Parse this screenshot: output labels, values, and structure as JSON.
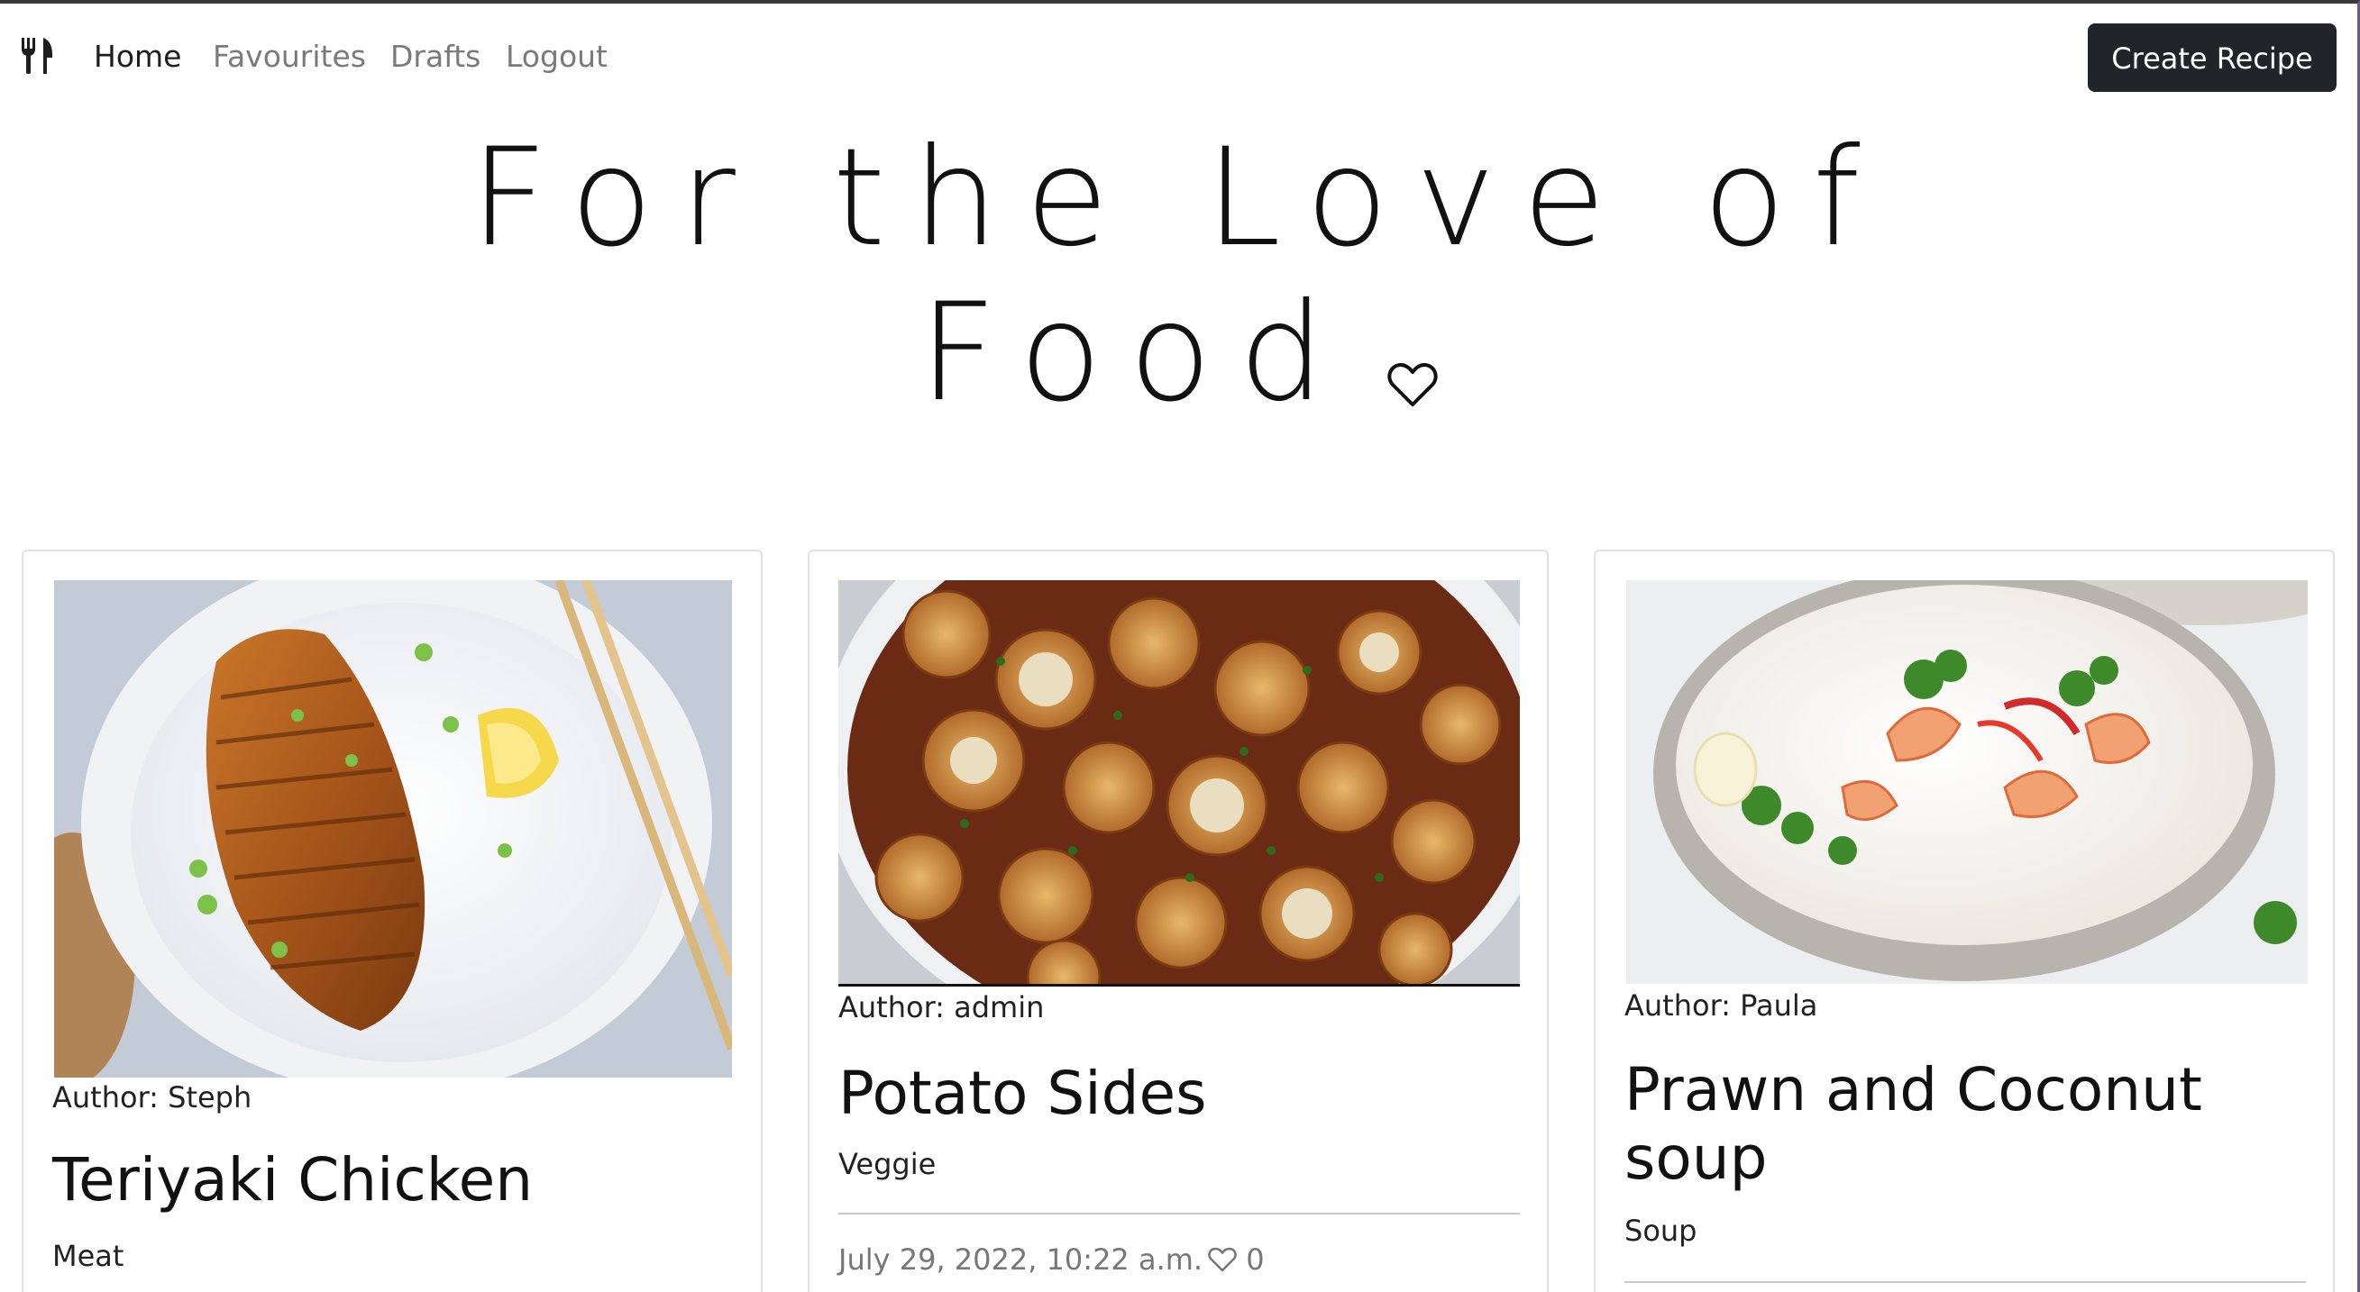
{
  "nav": {
    "brand_icon": "fork-knife-icon",
    "links": [
      "Home",
      "Favourites",
      "Drafts",
      "Logout"
    ],
    "active": "Home",
    "create_button": "Create Recipe"
  },
  "hero": {
    "line1": "For the Love of",
    "line2": "Food",
    "heart_icon": "heart-outline-icon"
  },
  "recipes": [
    {
      "author_label": "Author: Steph",
      "title": "Teriyaki Chicken",
      "category": "Meat",
      "image": "teriyaki-chicken-rice-bowl-photo"
    },
    {
      "author_label": "Author: admin",
      "title": "Potato Sides",
      "category": "Veggie",
      "date": "July 29, 2022, 10:22 a.m.",
      "likes": "0",
      "image": "roast-potatoes-bowl-photo"
    },
    {
      "author_label": "Author: Paula",
      "title": "Prawn and Coconut soup",
      "category": "Soup",
      "image": "prawn-coconut-soup-bowl-photo"
    }
  ],
  "colors": {
    "primary_button": "#212529",
    "nav_muted": "#7a7a7a",
    "meta_text": "#777777"
  }
}
